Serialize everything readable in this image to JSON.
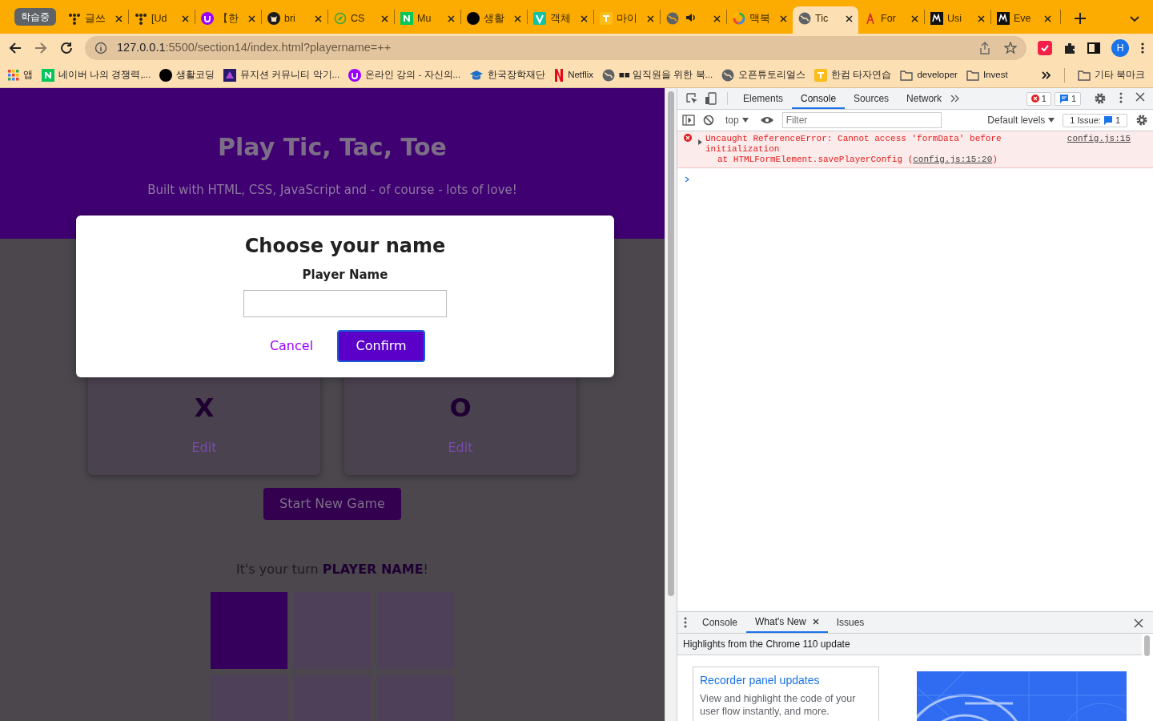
{
  "browser": {
    "tab_group": "학습중",
    "tabs": [
      {
        "kind": "dots",
        "title": "글쓰",
        "selected": false
      },
      {
        "kind": "dots",
        "title": "[Ud",
        "selected": false
      },
      {
        "kind": "u",
        "title": "【한",
        "selected": false
      },
      {
        "kind": "github",
        "title": "bri",
        "selected": false
      },
      {
        "kind": "leaf",
        "title": "CS",
        "selected": false
      },
      {
        "kind": "n",
        "title": "Mu",
        "selected": false
      },
      {
        "kind": "dot",
        "title": "생활",
        "selected": false
      },
      {
        "kind": "v",
        "title": "객체",
        "selected": false
      },
      {
        "kind": "tj",
        "title": "마이",
        "selected": false
      },
      {
        "kind": "audio",
        "selected": false
      },
      {
        "kind": "google",
        "title": "맥북",
        "selected": false
      },
      {
        "kind": "globe",
        "title": "Tic",
        "selected": true
      },
      {
        "kind": "tower",
        "title": "For",
        "selected": false
      },
      {
        "kind": "m",
        "title": "Usi",
        "selected": false
      },
      {
        "kind": "m",
        "title": "Eve",
        "selected": false
      }
    ],
    "address": {
      "host": "127.0.0.1",
      "rest": ":5500/section14/index.html?playername=++"
    },
    "profile_initial": "H",
    "bookmarks": [
      {
        "kind": "apps",
        "label": "앱"
      },
      {
        "kind": "n",
        "label": "네이버 나의 경쟁력,..."
      },
      {
        "kind": "dot",
        "label": "생활코딩"
      },
      {
        "kind": "mule",
        "label": "뮤지션 커뮤니티 악기..."
      },
      {
        "kind": "u",
        "label": "온라인 강의 - 자신의..."
      },
      {
        "kind": "cap",
        "label": "한국장학재단"
      },
      {
        "kind": "netflix",
        "label": "Netflix"
      },
      {
        "kind": "globe",
        "label": "■■ 임직원을 위한 복..."
      },
      {
        "kind": "globe",
        "label": "오픈튜토리얼스"
      },
      {
        "kind": "tj",
        "label": "한컴 타자연습"
      },
      {
        "kind": "folder",
        "label": "developer"
      },
      {
        "kind": "folder",
        "label": "Invest"
      }
    ],
    "other_bookmarks": "기타 북마크"
  },
  "page": {
    "title": "Play Tic, Tac, Toe",
    "subtitle": "Built with HTML, CSS, JavaScript and - of course - lots of love!",
    "players": [
      {
        "symbol": "X",
        "edit": "Edit"
      },
      {
        "symbol": "O",
        "edit": "Edit"
      }
    ],
    "start_button": "Start New Game",
    "turn_text": "It's your turn **PLAYER NAME**!",
    "board": [
      {
        "selected": true
      },
      {
        "selected": false
      },
      {
        "selected": false
      },
      {
        "selected": false
      },
      {
        "selected": false
      },
      {
        "selected": false
      }
    ],
    "modal": {
      "title": "Choose your name",
      "label": "Player Name",
      "cancel": "Cancel",
      "confirm": "Confirm"
    }
  },
  "devtools": {
    "tabs": [
      {
        "label": "Elements",
        "selected": false
      },
      {
        "label": "Console",
        "selected": true
      },
      {
        "label": "Sources",
        "selected": false
      },
      {
        "label": "Network",
        "selected": false
      }
    ],
    "error_count": "1",
    "message_count": "1",
    "context": "top",
    "filter_placeholder": "Filter",
    "levels": "Default levels",
    "issues_label": "1 Issue:",
    "issues_count": "1",
    "messages": [
      {
        "message": "Uncaught ReferenceError: Cannot access 'formData' before initialization",
        "stack_prefix": "at HTMLFormElement.savePlayerConfig (",
        "stack_link": "config.js:15:20",
        "stack_suffix": ")",
        "source": "config.js:15"
      }
    ],
    "drawer": {
      "tabs": [
        {
          "label": "Console",
          "selected": false,
          "closable": false
        },
        {
          "label": "What's New",
          "selected": true,
          "closable": true
        },
        {
          "label": "Issues",
          "selected": false,
          "closable": false
        }
      ],
      "header": "Highlights from the Chrome 110 update",
      "card": {
        "title": "Recorder panel updates",
        "text": "View and highlight the code of your user flow instantly, and more."
      }
    }
  }
}
